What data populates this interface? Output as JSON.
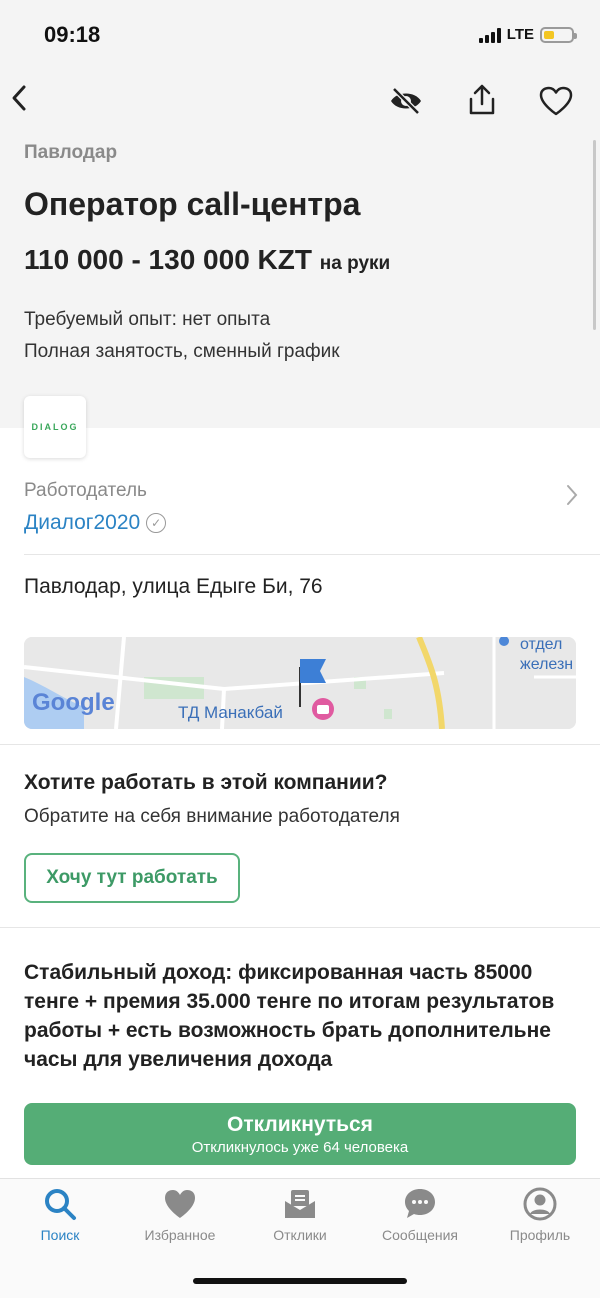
{
  "status_bar": {
    "time": "09:18",
    "network": "LTE"
  },
  "header": {
    "icons": [
      "back-icon",
      "hide-icon",
      "share-icon",
      "heart-icon"
    ]
  },
  "vacancy": {
    "city": "Павлодар",
    "title": "Оператор call-центра",
    "salary": "110 000 - 130 000 KZT",
    "salary_note": "на руки",
    "experience": "Требуемый опыт: нет опыта",
    "employment": "Полная занятость, сменный график"
  },
  "employer": {
    "logo_text": "DIALOG",
    "label": "Работодатель",
    "name": "Диалог2020"
  },
  "location": {
    "address": "Павлодар, улица Едыге Би, 76",
    "map_label": "ТД Манакбай",
    "map_brand": "Google",
    "map_poi": "отдел железн"
  },
  "cta_block": {
    "question": "Хотите работать в этой компании?",
    "subtitle": "Обратите на себя внимание работодателя",
    "button": "Хочу тут работать"
  },
  "description": "Стабильный доход: фиксированная часть 85000 тенге + премия 35.000 тенге по итогам результатов работы + есть возможность брать дополнительне часы для увеличения дохода",
  "apply": {
    "label": "Откликнуться",
    "sub": "Откликнулось уже 64 человека"
  },
  "tabbar": {
    "items": [
      {
        "label": "Поиск",
        "icon": "search-icon",
        "active": true
      },
      {
        "label": "Избранное",
        "icon": "heart-icon",
        "active": false
      },
      {
        "label": "Отклики",
        "icon": "envelope-icon",
        "active": false
      },
      {
        "label": "Сообщения",
        "icon": "chat-icon",
        "active": false
      },
      {
        "label": "Профиль",
        "icon": "profile-icon",
        "active": false
      }
    ]
  },
  "colors": {
    "accent_green": "#55ad76",
    "link_blue": "#2b83c4",
    "battery_yellow": "#f3c623"
  }
}
